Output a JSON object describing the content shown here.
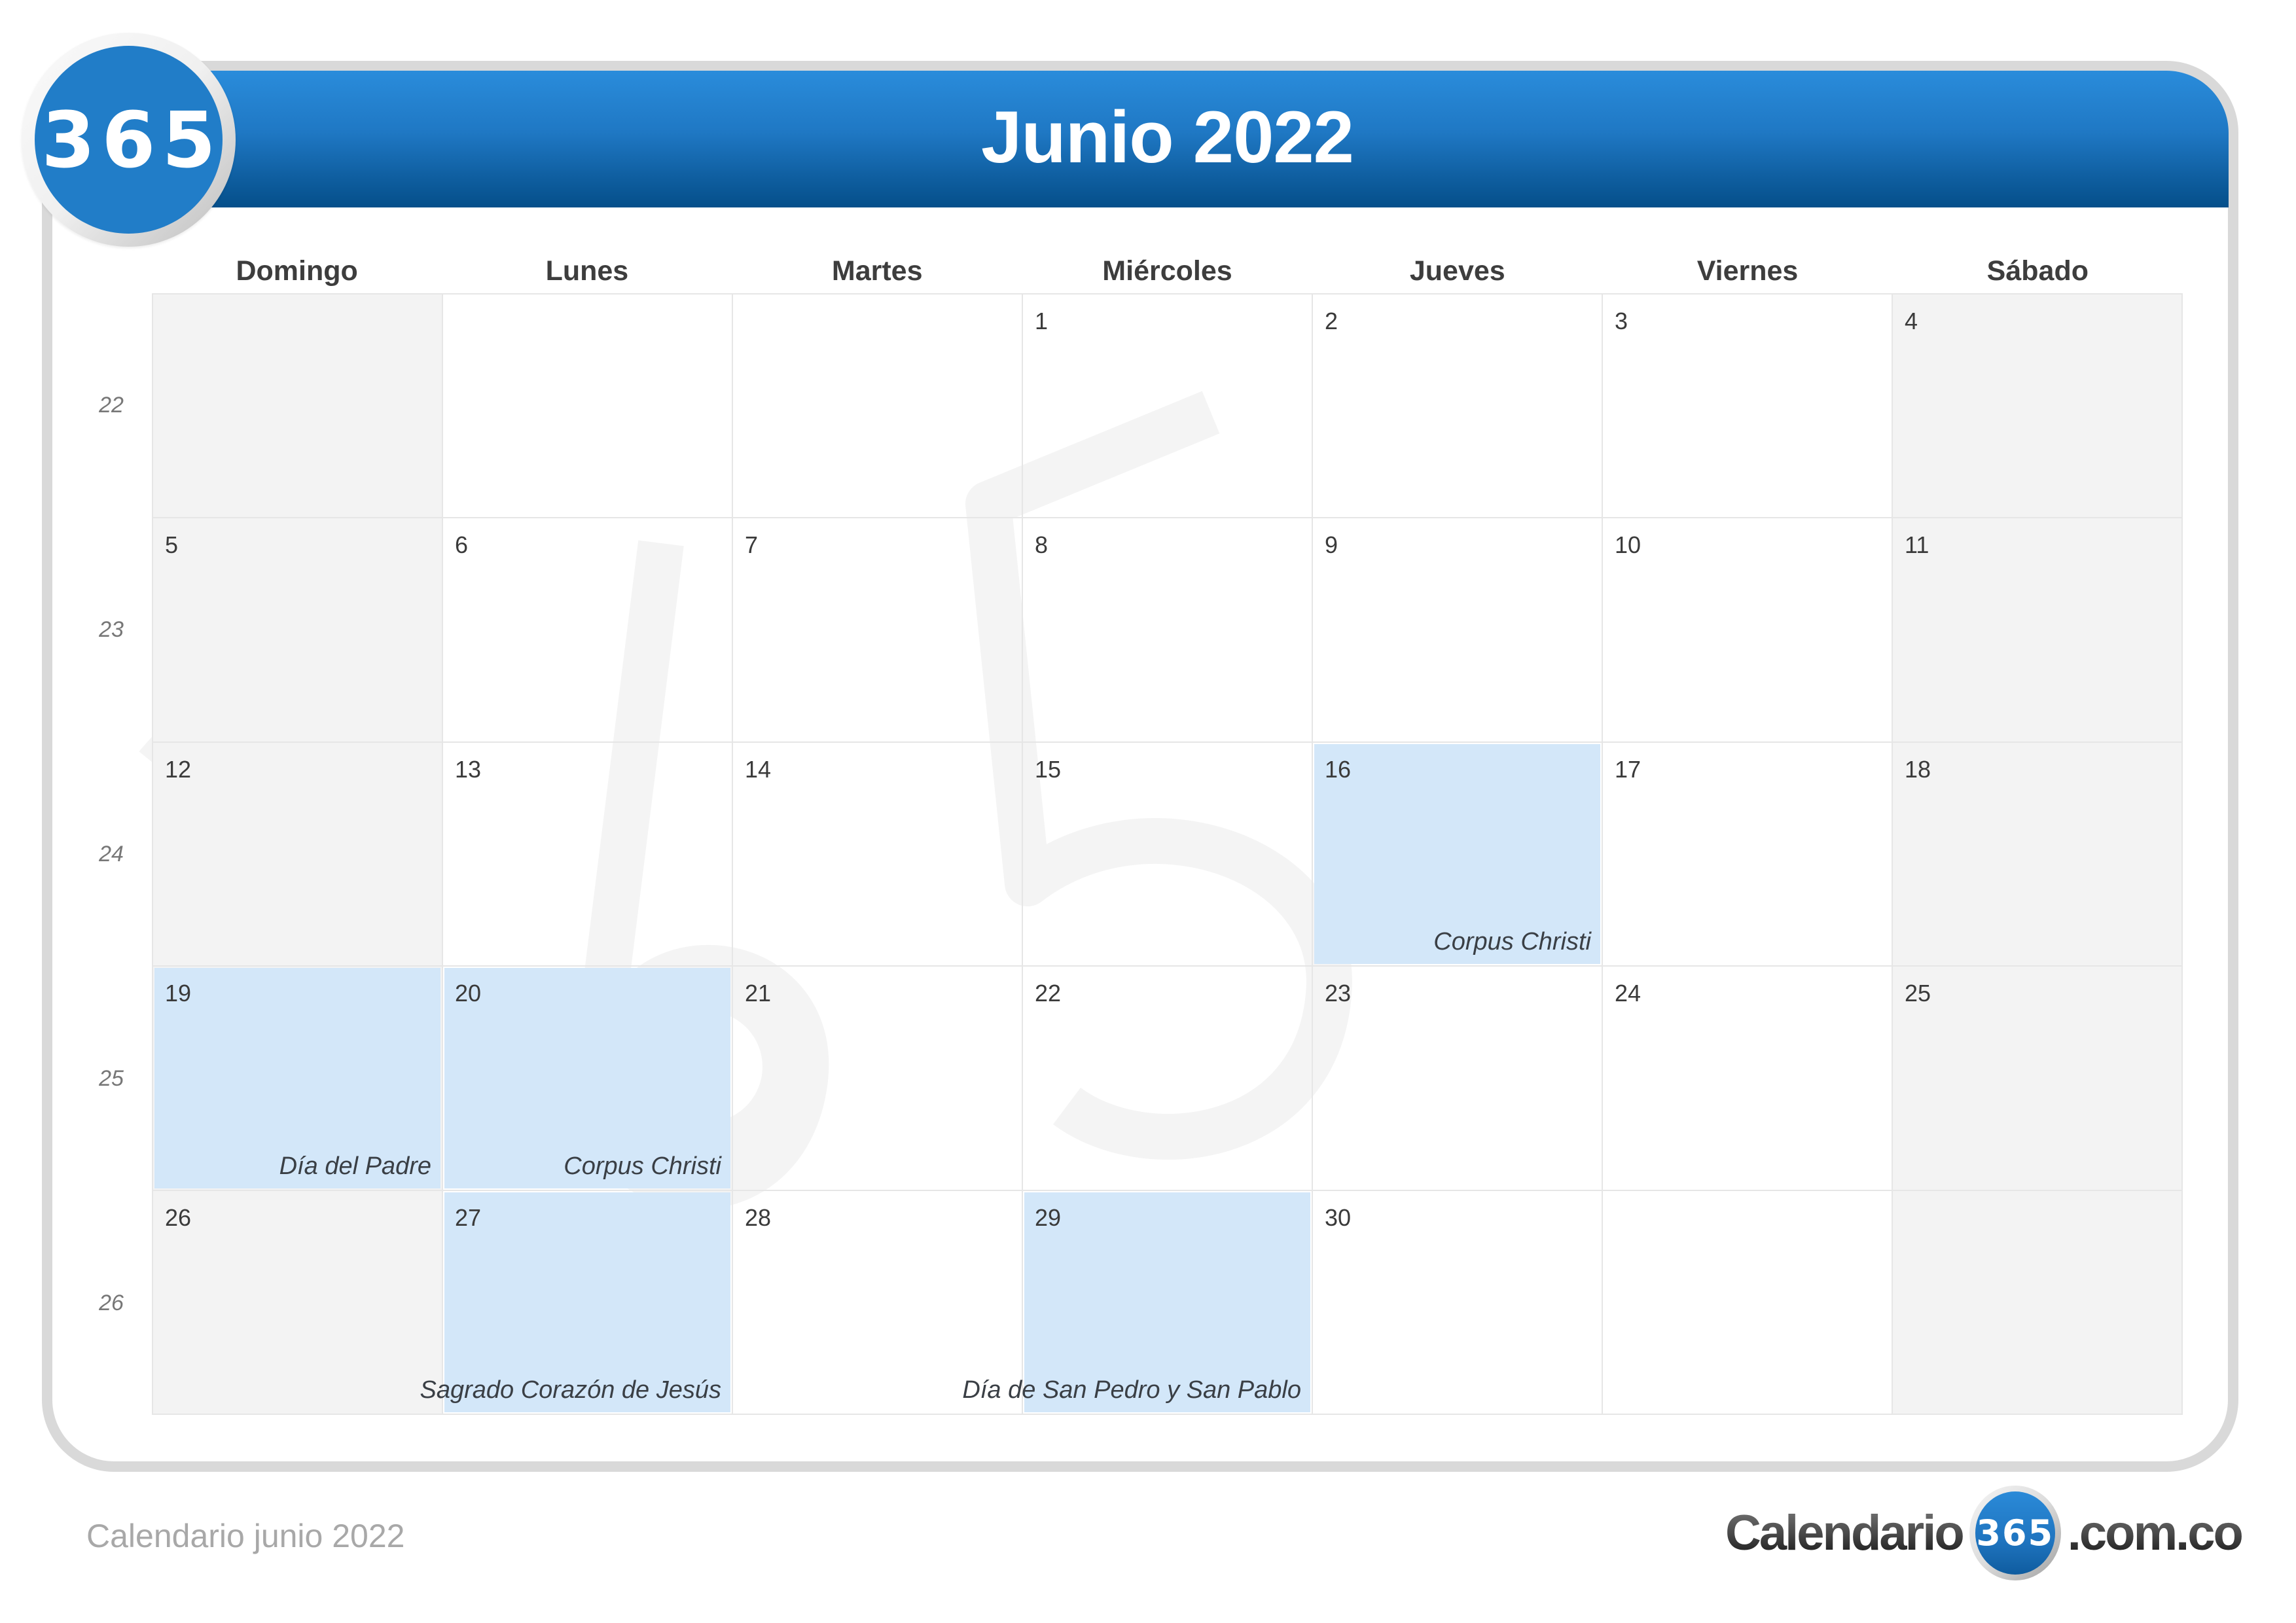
{
  "header": {
    "logo_text": "365",
    "title": "Junio 2022"
  },
  "colors": {
    "header_blue_top": "#2a8cdb",
    "header_blue_bottom": "#054f8a",
    "holiday_fill": "#d3e7f9",
    "weekend_fill": "#f2f2f2",
    "frame_gray": "#d9d9d9"
  },
  "weekdays": [
    "Domingo",
    "Lunes",
    "Martes",
    "Miércoles",
    "Jueves",
    "Viernes",
    "Sábado"
  ],
  "week_numbers": [
    "22",
    "23",
    "24",
    "25",
    "26"
  ],
  "weeks": [
    [
      {
        "day": "",
        "weekend": true
      },
      {
        "day": ""
      },
      {
        "day": ""
      },
      {
        "day": "1"
      },
      {
        "day": "2"
      },
      {
        "day": "3"
      },
      {
        "day": "4",
        "weekend": true
      }
    ],
    [
      {
        "day": "5",
        "weekend": true
      },
      {
        "day": "6"
      },
      {
        "day": "7"
      },
      {
        "day": "8"
      },
      {
        "day": "9"
      },
      {
        "day": "10"
      },
      {
        "day": "11",
        "weekend": true
      }
    ],
    [
      {
        "day": "12",
        "weekend": true
      },
      {
        "day": "13"
      },
      {
        "day": "14"
      },
      {
        "day": "15"
      },
      {
        "day": "16",
        "highlight": true,
        "holiday": "Corpus Christi"
      },
      {
        "day": "17"
      },
      {
        "day": "18",
        "weekend": true
      }
    ],
    [
      {
        "day": "19",
        "weekend": true,
        "highlight": true,
        "holiday": "Día del Padre"
      },
      {
        "day": "20",
        "highlight": true,
        "holiday": "Corpus Christi"
      },
      {
        "day": "21"
      },
      {
        "day": "22"
      },
      {
        "day": "23"
      },
      {
        "day": "24"
      },
      {
        "day": "25",
        "weekend": true
      }
    ],
    [
      {
        "day": "26",
        "weekend": true
      },
      {
        "day": "27",
        "highlight": true,
        "holiday": "Sagrado Corazón de Jesús"
      },
      {
        "day": "28"
      },
      {
        "day": "29",
        "highlight": true,
        "holiday": "Día de San Pedro y San Pablo"
      },
      {
        "day": "30"
      },
      {
        "day": ""
      },
      {
        "day": "",
        "weekend": true
      }
    ]
  ],
  "watermark": {
    "text": "365",
    "icon": "watermark-365-logo"
  },
  "footer": {
    "caption": "Calendario junio 2022",
    "brand_prefix": "Calendario",
    "brand_badge": "365",
    "brand_suffix": ".com.co"
  }
}
